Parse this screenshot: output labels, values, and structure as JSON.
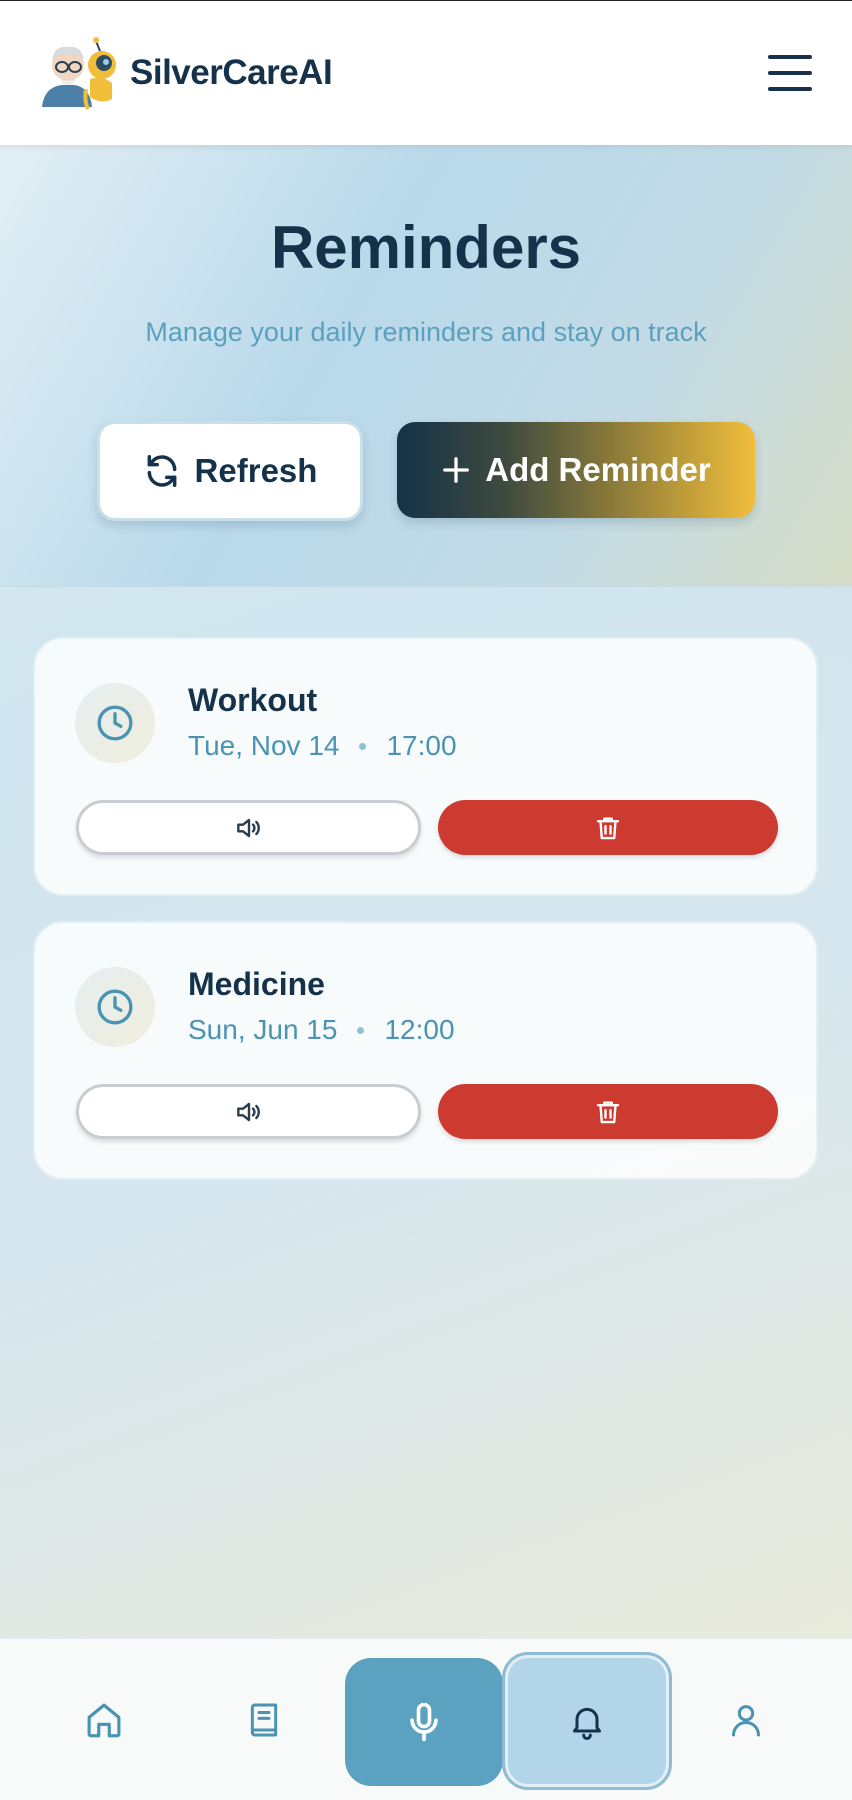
{
  "header": {
    "brand": "SilverCareAI",
    "logo_icon": "elderly-person-with-robot-logo",
    "menu_icon": "hamburger-menu-icon"
  },
  "hero": {
    "title": "Reminders",
    "subtitle": "Manage your daily reminders and stay on track",
    "refresh_label": "Refresh",
    "add_label": "Add Reminder"
  },
  "reminders": [
    {
      "title": "Workout",
      "date": "Tue, Nov 14",
      "time": "17:00"
    },
    {
      "title": "Medicine",
      "date": "Sun, Jun 15",
      "time": "12:00"
    }
  ],
  "nav": {
    "items": [
      "home",
      "journal",
      "microphone",
      "reminders",
      "profile"
    ],
    "active": "reminders"
  },
  "colors": {
    "navy": "#15324a",
    "accent_blue": "#5aa2bf",
    "danger_red": "#cd3a30",
    "gold": "#f1be3a",
    "subtitle_blue": "#5ba0be"
  }
}
